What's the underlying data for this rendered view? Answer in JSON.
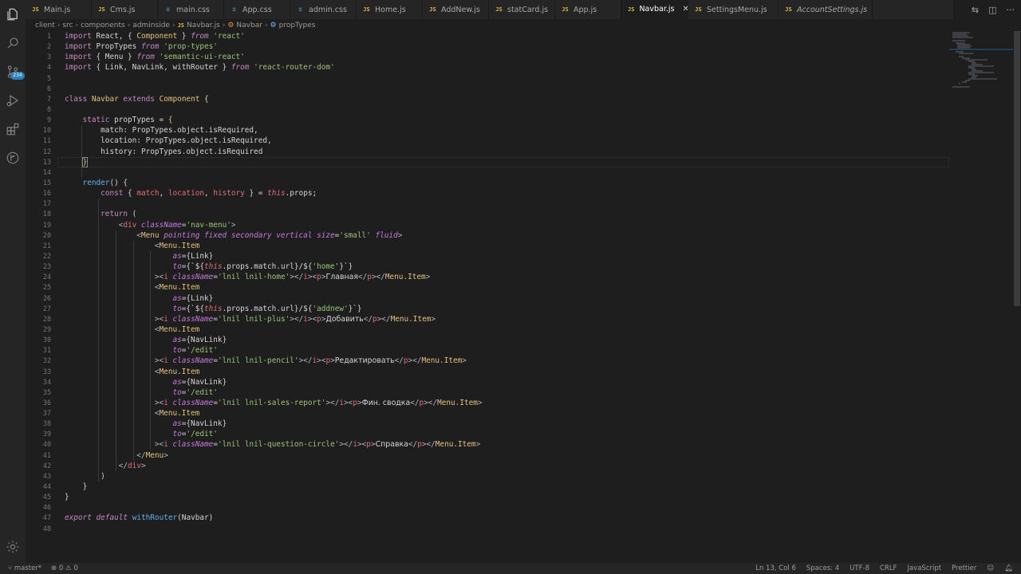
{
  "tabs": [
    {
      "label": "Main.js",
      "icon": "js-file-icon"
    },
    {
      "label": "Cms.js",
      "icon": "js-file-icon"
    },
    {
      "label": "main.css",
      "icon": "css-file-icon"
    },
    {
      "label": "App.css",
      "icon": "css-file-icon"
    },
    {
      "label": "admin.css",
      "icon": "css-file-icon"
    },
    {
      "label": "Home.js",
      "icon": "js-file-icon"
    },
    {
      "label": "AddNew.js",
      "icon": "js-file-icon"
    },
    {
      "label": "statCard.js",
      "icon": "js-file-icon"
    },
    {
      "label": "App.js",
      "icon": "js-file-icon"
    },
    {
      "label": "Navbar.js",
      "icon": "js-file-icon",
      "active": true
    },
    {
      "label": "SettingsMenu.js",
      "icon": "js-file-icon"
    },
    {
      "label": "AccountSettings.js",
      "icon": "js-file-icon",
      "italic": true
    }
  ],
  "breadcrumb": [
    "client",
    "src",
    "components",
    "adminside",
    "Navbar.js",
    "Navbar",
    "propTypes"
  ],
  "activity": {
    "scm_badge": "234"
  },
  "line_numbers": [
    "1",
    "2",
    "3",
    "4",
    "5",
    "6",
    "7",
    "8",
    "9",
    "10",
    "11",
    "12",
    "13",
    "14",
    "15",
    "16",
    "17",
    "18",
    "19",
    "20",
    "21",
    "22",
    "23",
    "24",
    "25",
    "26",
    "27",
    "28",
    "29",
    "30",
    "31",
    "32",
    "33",
    "34",
    "35",
    "36",
    "37",
    "38",
    "39",
    "40",
    "41",
    "42",
    "43",
    "44",
    "45",
    "46",
    "47",
    "48"
  ],
  "code": {
    "l1": [
      "import",
      " React, { ",
      "Component",
      " } ",
      "from",
      " ",
      "'react'"
    ],
    "l2": [
      "import",
      " PropTypes ",
      "from",
      " ",
      "'prop-types'"
    ],
    "l3": [
      "import",
      " { Menu } ",
      "from",
      " ",
      "'semantic-ui-react'"
    ],
    "l4": [
      "import",
      " { Link, NavLink, withRouter } ",
      "from",
      " ",
      "'react-router-dom'"
    ],
    "l7": [
      "class",
      " ",
      "Navbar",
      " ",
      "extends",
      " ",
      "Component",
      " {"
    ],
    "l9": [
      "    ",
      "static",
      " propTypes = ",
      "{"
    ],
    "l10": "        match: PropTypes.object.isRequired,",
    "l11": "        location: PropTypes.object.isRequired,",
    "l12": "        history: PropTypes.object.isRequired",
    "l13": [
      "    ",
      "}"
    ],
    "l15": [
      "    ",
      "render",
      "() {"
    ],
    "l16": [
      "        ",
      "const",
      " { ",
      "match",
      ", ",
      "location",
      ", ",
      "history",
      " } = ",
      "this",
      ".props;"
    ],
    "l18": [
      "        ",
      "return",
      " ("
    ],
    "l19": [
      "            <",
      "div",
      " ",
      "className",
      "=",
      "'nav-menu'",
      ">"
    ],
    "l20": [
      "                <",
      "Menu",
      " ",
      "pointing fixed secondary vertical size",
      "=",
      "'small'",
      " ",
      "fluid",
      ">"
    ],
    "l21": [
      "                    <",
      "Menu.Item"
    ],
    "l22": [
      "                        ",
      "as",
      "={Link}"
    ],
    "l23": [
      "                        ",
      "to",
      "={`${",
      "this",
      ".props.match.url}/${",
      "'home'",
      "}`}"
    ],
    "l24": [
      "                    ><",
      "i",
      " ",
      "className",
      "=",
      "'lnil lnil-home'",
      "></",
      "i",
      "><",
      "p",
      ">",
      "Главная",
      "</",
      "p",
      "></",
      "Menu.Item",
      ">"
    ],
    "l25": [
      "                    <",
      "Menu.Item"
    ],
    "l26": [
      "                        ",
      "as",
      "={Link}"
    ],
    "l27": [
      "                        ",
      "to",
      "={`${",
      "this",
      ".props.match.url}/${",
      "'addnew'",
      "}`}"
    ],
    "l28": [
      "                    ><",
      "i",
      " ",
      "className",
      "=",
      "'lnil lnil-plus'",
      "></",
      "i",
      "><",
      "p",
      ">",
      "Добавить",
      "</",
      "p",
      "></",
      "Menu.Item",
      ">"
    ],
    "l29": [
      "                    <",
      "Menu.Item"
    ],
    "l30": [
      "                        ",
      "as",
      "={NavLink}"
    ],
    "l31": [
      "                        ",
      "to",
      "=",
      "'/edit'"
    ],
    "l32": [
      "                    ><",
      "i",
      " ",
      "className",
      "=",
      "'lnil lnil-pencil'",
      "></",
      "i",
      "><",
      "p",
      ">",
      "Редактировать",
      "</",
      "p",
      "></",
      "Menu.Item",
      ">"
    ],
    "l33": [
      "                    <",
      "Menu.Item"
    ],
    "l34": [
      "                        ",
      "as",
      "={NavLink}"
    ],
    "l35": [
      "                        ",
      "to",
      "=",
      "'/edit'"
    ],
    "l36": [
      "                    ><",
      "i",
      " ",
      "className",
      "=",
      "'lnil lnil-sales-report'",
      "></",
      "i",
      "><",
      "p",
      ">",
      "Фин. сводка",
      "</",
      "p",
      "></",
      "Menu.Item",
      ">"
    ],
    "l37": [
      "                    <",
      "Menu.Item"
    ],
    "l38": [
      "                        ",
      "as",
      "={NavLink}"
    ],
    "l39": [
      "                        ",
      "to",
      "=",
      "'/edit'"
    ],
    "l40": [
      "                    ><",
      "i",
      " ",
      "className",
      "=",
      "'lnil lnil-question-circle'",
      "></",
      "i",
      "><",
      "p",
      ">",
      "Справка",
      "</",
      "p",
      "></",
      "Menu.Item",
      ">"
    ],
    "l41": [
      "                </",
      "Menu",
      ">"
    ],
    "l42": [
      "            </",
      "div",
      ">"
    ],
    "l43": "        )",
    "l44": "    }",
    "l45": "}",
    "l47": [
      "export",
      " ",
      "default",
      " ",
      "withRouter",
      "(Navbar)"
    ]
  },
  "status": {
    "branch": "master*",
    "errors": "0",
    "warnings": "0",
    "position": "Ln 13, Col 6",
    "spaces": "Spaces: 4",
    "encoding": "UTF-8",
    "eol": "CRLF",
    "language": "JavaScript",
    "formatter": "Prettier"
  }
}
